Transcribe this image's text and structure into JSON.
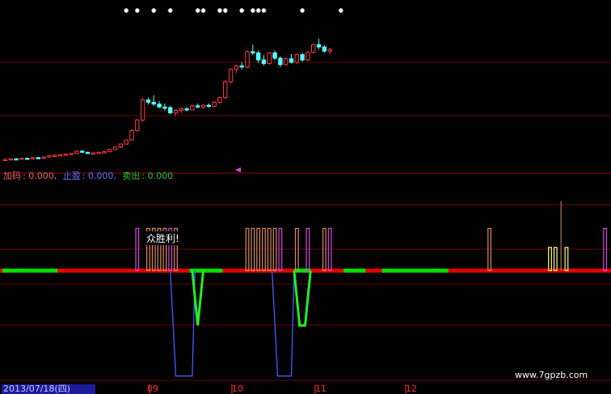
{
  "indicator_legend": {
    "jiama_label": "加码",
    "jiama_value": ": 0.000,",
    "zhiying_label": "止盈",
    "zhiying_value": ": 0.000,",
    "maichu_label": "卖出",
    "maichu_value": ": 0.000"
  },
  "annotation": "众胜利!",
  "cursor_date": "2013/07/18(四)",
  "month_labels": [
    "09",
    "10",
    "11",
    "12"
  ],
  "watermark": "www.7gpzb.com",
  "colors": {
    "background": "#000000",
    "candle_up": "#ff3b3b",
    "candle_down": "#54ffff",
    "grid": "#6a0000",
    "bar_orange": "#d98b5f",
    "bar_magenta": "#d84ad8",
    "bar_yellow": "#ffff80",
    "axis_red": "#e00000",
    "axis_green": "#00dd00",
    "line_blue": "#4060ff",
    "line_green": "#22ee22",
    "marker": "#ffffff"
  },
  "chart_data": [
    {
      "type": "candlestick",
      "panel": "price",
      "series": [
        {
          "name": "",
          "ohlc": [
            [
              10,
              10.2,
              9.9,
              10.1
            ],
            [
              10.1,
              10.3,
              10,
              10.2
            ],
            [
              10.2,
              10.3,
              10,
              10.1
            ],
            [
              10.1,
              10.4,
              10,
              10.3
            ],
            [
              10.3,
              10.4,
              10.1,
              10.2
            ],
            [
              10.2,
              10.5,
              10.1,
              10.4
            ],
            [
              10.4,
              10.5,
              10.2,
              10.3
            ],
            [
              10.3,
              10.6,
              10.2,
              10.5
            ],
            [
              10.5,
              10.8,
              10.4,
              10.7
            ],
            [
              10.7,
              10.9,
              10.5,
              10.8
            ],
            [
              10.8,
              11,
              10.7,
              10.9
            ],
            [
              10.9,
              11.1,
              10.7,
              11
            ],
            [
              11,
              11.2,
              10.9,
              11.1
            ],
            [
              11.1,
              11.6,
              11,
              11.5
            ],
            [
              11.5,
              11.7,
              11.2,
              11.3
            ],
            [
              11.3,
              11.4,
              11,
              11.1
            ],
            [
              11.1,
              11.3,
              10.9,
              11.2
            ],
            [
              11.2,
              11.4,
              11,
              11.3
            ],
            [
              11.3,
              11.5,
              11.1,
              11.4
            ],
            [
              11.4,
              11.9,
              11.3,
              11.8
            ],
            [
              11.8,
              12.3,
              11.7,
              12.2
            ],
            [
              12.2,
              12.8,
              12,
              12.7
            ],
            [
              12.7,
              13.5,
              12.6,
              13.4
            ],
            [
              13.4,
              15.2,
              13.3,
              15
            ],
            [
              15,
              17,
              14.8,
              16.8
            ],
            [
              16.8,
              20.5,
              16.5,
              20.2
            ],
            [
              20.2,
              20.6,
              19.4,
              19.8
            ],
            [
              19.8,
              21,
              19.2,
              19.5
            ],
            [
              19.5,
              20,
              18.8,
              19
            ],
            [
              19,
              19.6,
              18.4,
              18.9
            ],
            [
              18.9,
              19.2,
              17.8,
              18
            ],
            [
              18,
              18.6,
              17.5,
              18.4
            ],
            [
              18.4,
              18.9,
              18,
              18.7
            ],
            [
              18.7,
              19,
              18.3,
              18.5
            ],
            [
              18.5,
              19.4,
              18.4,
              19.2
            ],
            [
              19.2,
              19.6,
              18.8,
              19
            ],
            [
              19,
              19.5,
              18.7,
              19.3
            ],
            [
              19.3,
              19.6,
              18.9,
              19.1
            ],
            [
              19.1,
              20,
              19,
              19.8
            ],
            [
              19.8,
              20.8,
              19.6,
              20.6
            ],
            [
              20.6,
              23.6,
              20.4,
              23.3
            ],
            [
              23.3,
              25.6,
              23,
              25.4
            ],
            [
              25.4,
              26.2,
              24.8,
              26
            ],
            [
              26,
              26.6,
              25.4,
              25.8
            ],
            [
              25.8,
              28.6,
              25.6,
              28.4
            ],
            [
              28.4,
              29.6,
              27.8,
              28.2
            ],
            [
              28.2,
              28.6,
              26.5,
              27
            ],
            [
              27,
              27.8,
              26,
              26.4
            ],
            [
              26.4,
              28.4,
              26.2,
              28.2
            ],
            [
              28.2,
              28.6,
              27,
              27.3
            ],
            [
              27.3,
              27.6,
              25.8,
              26.2
            ],
            [
              26.2,
              27.4,
              26,
              27.2
            ],
            [
              27.2,
              28,
              26.4,
              26.6
            ],
            [
              26.6,
              28.1,
              26.3,
              27.9
            ],
            [
              27.9,
              28.2,
              26.7,
              27
            ],
            [
              27,
              28.5,
              26.8,
              28.3
            ],
            [
              28.3,
              29.8,
              28.1,
              29.6
            ],
            [
              29.6,
              30.6,
              28.8,
              29.2
            ],
            [
              29.2,
              29.5,
              28.2,
              28.5
            ],
            [
              28.5,
              29.1,
              28,
              28.8
            ]
          ]
        }
      ],
      "ylim": [
        9,
        31
      ]
    },
    {
      "type": "bar",
      "panel": "indicator",
      "bars": [
        {
          "i": 24,
          "v": 1,
          "c": "magenta"
        },
        {
          "i": 26,
          "v": 1,
          "c": "orange"
        },
        {
          "i": 27,
          "v": 1,
          "c": "orange"
        },
        {
          "i": 28,
          "v": 1,
          "c": "orange"
        },
        {
          "i": 29,
          "v": 1,
          "c": "orange"
        },
        {
          "i": 30,
          "v": 1,
          "c": "magenta"
        },
        {
          "i": 31,
          "v": 1,
          "c": "orange"
        },
        {
          "i": 44,
          "v": 1,
          "c": "orange"
        },
        {
          "i": 45,
          "v": 1,
          "c": "orange"
        },
        {
          "i": 46,
          "v": 1,
          "c": "orange"
        },
        {
          "i": 47,
          "v": 1,
          "c": "orange"
        },
        {
          "i": 48,
          "v": 1,
          "c": "orange"
        },
        {
          "i": 49,
          "v": 1,
          "c": "orange"
        },
        {
          "i": 50,
          "v": 1,
          "c": "magenta"
        },
        {
          "i": 53,
          "v": 1,
          "c": "orange"
        },
        {
          "i": 55,
          "v": 1,
          "c": "magenta"
        },
        {
          "i": 58,
          "v": 1,
          "c": "orange"
        },
        {
          "i": 59,
          "v": 1,
          "c": "magenta"
        },
        {
          "i": 88,
          "v": 1,
          "c": "orange"
        },
        {
          "i": 99,
          "v": 0.55,
          "c": "yellow"
        },
        {
          "i": 100,
          "v": 0.55,
          "c": "yellow"
        },
        {
          "i": 101,
          "v": 1.65,
          "c": "orange"
        },
        {
          "i": 102,
          "v": 0.55,
          "c": "yellow"
        },
        {
          "i": 109,
          "v": 1,
          "c": "magenta"
        }
      ],
      "blue_line": [
        {
          "i": 30,
          "v": 0
        },
        {
          "i": 31,
          "v": -2.5
        },
        {
          "i": 34,
          "v": -2.5
        },
        {
          "i": 34.5,
          "v": 0
        },
        {
          "i": 48.5,
          "v": 0
        },
        {
          "i": 49.5,
          "v": -2.5
        },
        {
          "i": 52,
          "v": -2.5
        },
        {
          "i": 52.5,
          "v": 0
        }
      ],
      "green_line": [
        {
          "i": 34,
          "v": 0
        },
        {
          "i": 35,
          "v": -1.3
        },
        {
          "i": 36,
          "v": 0
        },
        {
          "i": 52.5,
          "v": 0
        },
        {
          "i": 53.5,
          "v": -1.3
        },
        {
          "i": 54.5,
          "v": -1.3
        },
        {
          "i": 55.5,
          "v": 0
        }
      ],
      "axis_segments": [
        {
          "from": 0,
          "to": 4,
          "c": "green"
        },
        {
          "from": 5,
          "to": 9,
          "c": "green"
        },
        {
          "from": 34,
          "to": 39,
          "c": "green"
        },
        {
          "from": 53,
          "to": 55,
          "c": "green"
        },
        {
          "from": 62,
          "to": 65,
          "c": "green"
        },
        {
          "from": 69,
          "to": 80,
          "c": "green"
        }
      ],
      "ylim": [
        -2.6,
        2.1
      ]
    }
  ],
  "signal_marker_positions": [
    22,
    24,
    27,
    30,
    35,
    36,
    39,
    40,
    43,
    45,
    46,
    47,
    54,
    61
  ],
  "bar_count": 110
}
